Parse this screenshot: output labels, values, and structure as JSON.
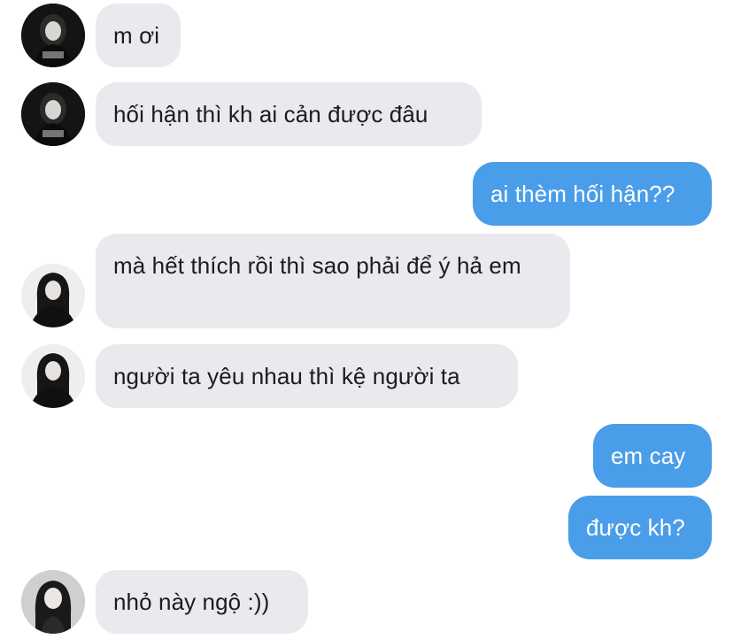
{
  "colors": {
    "incoming_bubble": "#e9e9ee",
    "outgoing_bubble": "#4a9de8",
    "incoming_text": "#1c1c1e",
    "outgoing_text": "#ffffff"
  },
  "messages": [
    {
      "direction": "incoming",
      "sender": "contact-a",
      "text": "m ơi"
    },
    {
      "direction": "incoming",
      "sender": "contact-a",
      "text": "hối hận thì kh ai cản được đâu"
    },
    {
      "direction": "outgoing",
      "text": "ai thèm hối hận??"
    },
    {
      "direction": "incoming",
      "sender": "contact-b",
      "text": "mà hết thích rồi thì sao phải để ý hả em"
    },
    {
      "direction": "incoming",
      "sender": "contact-b",
      "text": "người ta yêu nhau thì kệ người ta"
    },
    {
      "direction": "outgoing",
      "text": "em cay"
    },
    {
      "direction": "outgoing",
      "text": "được kh?"
    },
    {
      "direction": "incoming",
      "sender": "contact-c",
      "text": "nhỏ này ngộ :))"
    }
  ]
}
